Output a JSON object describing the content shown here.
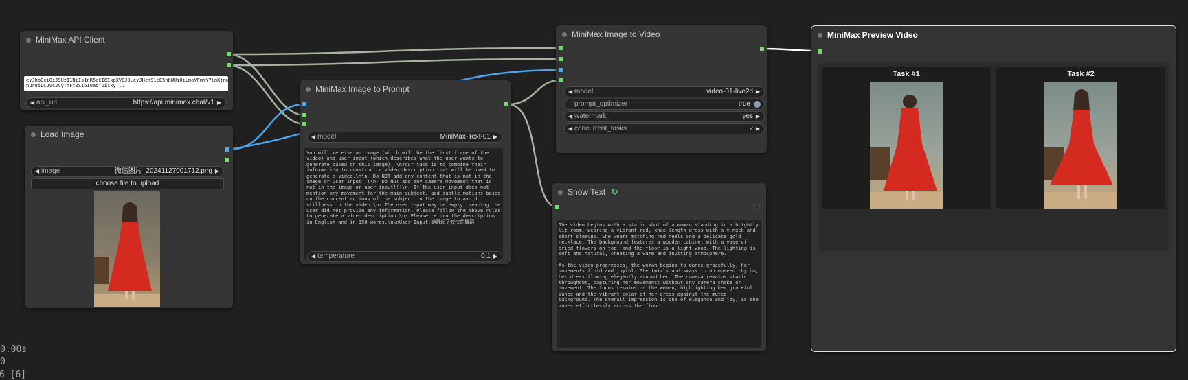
{
  "colors": {
    "background": "#202020",
    "node": "#353535",
    "port_green": "#6fdc66",
    "port_blue": "#4ea6f0",
    "wire_gray": "#a8b4a0",
    "wire_blue": "#4ea6f0"
  },
  "api_client": {
    "title": "MiniMax API Client",
    "api_key_text": "eyJhbGciOiJSUzI1NiIsInR5cCI6IkpXVCJ9.eyJHcm91cE5hbWUiOiLmoYFmmY7lnKjnur8iLCJVc2VyTmFtZSI6Iuadjuiiky...\nnur8iLCJVc2VyTmFtZSI6Iuadjuiiky...",
    "api_url_label": "api_url",
    "api_url_value": "https://api.minimax.chat/v1"
  },
  "load_image": {
    "title": "Load Image",
    "image_label": "image",
    "image_value": "微信图片_20241127001712.png",
    "upload_button": "choose file to upload"
  },
  "image_to_prompt": {
    "title": "MiniMax Image to Prompt",
    "model_label": "model",
    "model_value": "MiniMax-Text-01",
    "prompt_text": "You will receive an image (which will be the first frame of the video) and user input (which describes what the user wants to generate based on this image). \\nYour task is to combine their information to construct a video description that will be used to generate a video.\\n\\n- Do NOT add any content that is not in the image or user input!!!\\n- Do NOT add any camera movement that is not in the image or user input!!!\\n- If the user input does not mention any movement for the main subject, add subtle motions based on the current actions of the subject in the image to avoid stillness in the video.\\n- The user input may be empty, meaning the user did not provide any information. Please follow the above rules to generate a video description.\\n- Please return the description in English and in 150 words.\\n\\nUser Input:她跳起了欢快的舞蹈",
    "temperature_label": "temperature",
    "temperature_value": "0.1"
  },
  "image_to_video": {
    "title": "MiniMax Image to Video",
    "model_label": "model",
    "model_value": "video-01-live2d",
    "prompt_optimizer_label": "prompt_optimizer",
    "prompt_optimizer_value": "true",
    "watermark_label": "watermark",
    "watermark_value": "yes",
    "concurrent_tasks_label": "concurrent_tasks",
    "concurrent_tasks_value": "2"
  },
  "show_text": {
    "title": "Show Text",
    "text": "The video begins with a static shot of a woman standing in a brightly lit room, wearing a vibrant red, knee-length dress with a v-neck and short sleeves. She wears matching red heels and a delicate gold necklace. The background features a wooden cabinet with a vase of dried flowers on top, and the floor is a light wood. The lighting is soft and natural, creating a warm and inviting atmosphere.\n\nAs the video progresses, the woman begins to dance gracefully, her movements fluid and joyful. She twirls and sways to an unseen rhythm, her dress flowing elegantly around her. The camera remains static throughout, capturing her movements without any camera shake or movement. The focus remains on the woman, highlighting her graceful dance and the vibrant color of her dress against the muted background. The overall impression is one of elegance and joy, as she moves effortlessly across the floor."
  },
  "preview_video": {
    "title": "MiniMax Preview Video",
    "tasks": [
      {
        "label": "Task #1"
      },
      {
        "label": "Task #2"
      }
    ]
  },
  "stats": {
    "line1": "0.00s",
    "line2": "0",
    "line3": "6 [6]"
  }
}
